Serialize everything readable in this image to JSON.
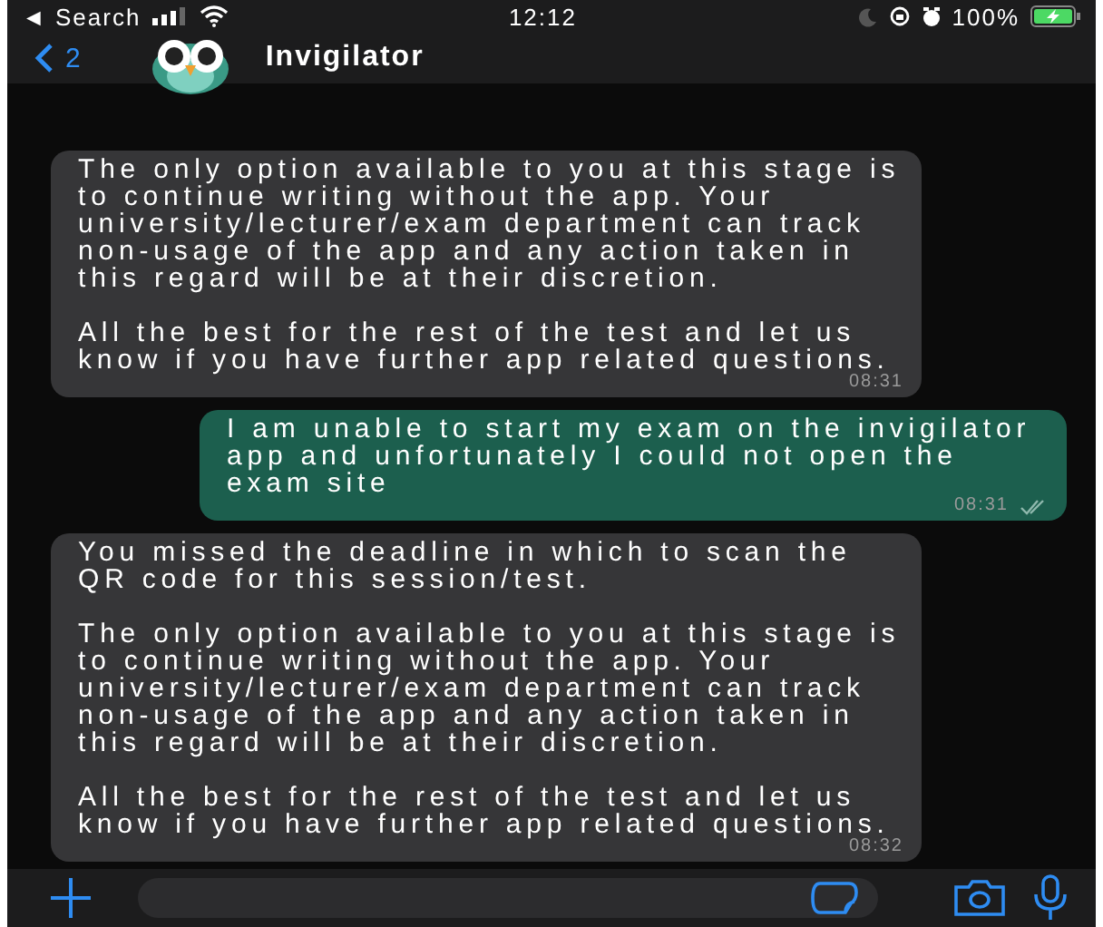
{
  "status_bar": {
    "back_label": "◄ Search",
    "time": "12:12",
    "battery": "100%"
  },
  "header": {
    "back_count": "2",
    "title": "Invigilator"
  },
  "messages": [
    {
      "kind": "incoming",
      "paragraphs": [
        "The only option available to you at this stage is to continue writing without the app. Your university/lecturer/exam department can track non-usage of the app and any action taken in this regard will be at their discretion.",
        "All the best for the rest of the test and let us know if you have further app related questions."
      ],
      "time": "08:31",
      "read": false
    },
    {
      "kind": "outgoing",
      "paragraphs": [
        "I am unable to start my exam on the invigilator app and unfortunately I could not open the exam site"
      ],
      "time": "08:31",
      "read": true
    },
    {
      "kind": "incoming",
      "paragraphs": [
        "You missed the deadline in which to scan the QR code for this session/test.",
        "The only option available to you at this stage is to continue writing without the app. Your university/lecturer/exam department can track non-usage of the app and any action taken in this regard will be at their discretion.",
        "All the best for the rest of the test and let us know if you have further app related questions."
      ],
      "time": "08:32",
      "read": false
    }
  ]
}
